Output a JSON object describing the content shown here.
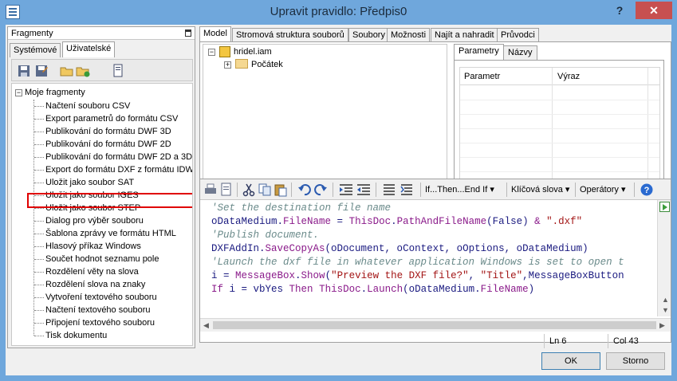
{
  "window": {
    "title": "Upravit pravidlo: Předpis0",
    "help_label": "?",
    "close_label": "✕"
  },
  "fragments": {
    "header": "Fragmenty",
    "tabs": [
      "Systémové",
      "Uživatelské"
    ],
    "active_tab": "Uživatelské",
    "toolbar_icons": [
      "save-icon",
      "save-as-icon",
      "open-folder-icon",
      "add-folder-icon",
      "document-icon"
    ],
    "root_label": "Moje fragmenty",
    "items": [
      "Načtení souboru CSV",
      "Export parametrů do formátu CSV",
      "Publikování do formátu DWF 3D",
      "Publikování do formátu DWF 2D",
      "Publikování do formátu DWF 2D a 3D",
      "Export do formátu DXF z formátu IDW",
      "Uložit jako soubor SAT",
      "Uložit jako soubor IGES",
      "Uložit jako soubor STEP",
      "Dialog pro výběr souboru",
      "Šablona zprávy ve formátu HTML",
      "Hlasový příkaz Windows",
      "Součet hodnot seznamu pole",
      "Rozdělení věty na slova",
      "Rozdělení slova na znaky",
      "Vytvoření textového souboru",
      "Načtení textového souboru",
      "Připojení textového souboru",
      "Tisk dokumentu"
    ],
    "highlighted_item": "Export do formátu DXF z formátu IDW"
  },
  "main_tabs": [
    "Model",
    "Stromová struktura souborů",
    "Soubory",
    "Možnosti",
    "Najít a nahradit",
    "Průvodci"
  ],
  "active_main_tab": "Model",
  "model_tree": {
    "root": "hridel.iam",
    "child": "Počátek"
  },
  "params_panel": {
    "tabs": [
      "Parametry",
      "Názvy"
    ],
    "active_tab": "Parametry",
    "columns": [
      "Parametr",
      "Výraz"
    ]
  },
  "editor_toolbar": {
    "icons": [
      "print-icon",
      "print-preview-icon",
      "cut-icon",
      "copy-icon",
      "paste-icon",
      "undo-icon",
      "redo-icon",
      "indent-icon",
      "outdent-icon",
      "comment-icon",
      "uncomment-icon"
    ],
    "dropdowns": [
      "If...Then...End If",
      "Klíčová slova",
      "Operátory"
    ],
    "help_icon": "help-icon"
  },
  "code_lines": [
    {
      "parts": [
        {
          "t": "'Set the destination file name",
          "c": "c-com"
        }
      ]
    },
    {
      "parts": [
        {
          "t": "oDataMedium",
          "c": "c-plain"
        },
        {
          "t": ".",
          "c": "c-plain"
        },
        {
          "t": "FileName",
          "c": "c-obj"
        },
        {
          "t": " = ",
          "c": "c-plain"
        },
        {
          "t": "ThisDoc",
          "c": "c-obj"
        },
        {
          "t": ".",
          "c": "c-plain"
        },
        {
          "t": "PathAndFileName",
          "c": "c-obj"
        },
        {
          "t": "(False) ",
          "c": "c-plain"
        },
        {
          "t": "&",
          "c": "c-kw"
        },
        {
          "t": " ",
          "c": "c-plain"
        },
        {
          "t": "\".dxf\"",
          "c": "c-str"
        }
      ]
    },
    {
      "parts": [
        {
          "t": "'Publish document.",
          "c": "c-com"
        }
      ]
    },
    {
      "parts": [
        {
          "t": "DXFAddIn",
          "c": "c-plain"
        },
        {
          "t": ".",
          "c": "c-plain"
        },
        {
          "t": "SaveCopyAs",
          "c": "c-obj"
        },
        {
          "t": "(oDocument, oContext, oOptions, oDataMedium)",
          "c": "c-plain"
        }
      ]
    },
    {
      "parts": [
        {
          "t": "'Launch the dxf file in whatever application Windows is set to open t",
          "c": "c-com"
        }
      ]
    },
    {
      "parts": [
        {
          "t": "i = ",
          "c": "c-plain"
        },
        {
          "t": "MessageBox",
          "c": "c-obj"
        },
        {
          "t": ".",
          "c": "c-plain"
        },
        {
          "t": "Show",
          "c": "c-obj"
        },
        {
          "t": "(",
          "c": "c-plain"
        },
        {
          "t": "\"Preview the DXF file?\"",
          "c": "c-str"
        },
        {
          "t": ", ",
          "c": "c-plain"
        },
        {
          "t": "\"Title\"",
          "c": "c-str"
        },
        {
          "t": ",MessageBoxButton",
          "c": "c-plain"
        }
      ]
    },
    {
      "parts": [
        {
          "t": "If",
          "c": "c-kw"
        },
        {
          "t": " i = vbYes ",
          "c": "c-plain"
        },
        {
          "t": "Then",
          "c": "c-kw"
        },
        {
          "t": " ",
          "c": "c-plain"
        },
        {
          "t": "ThisDoc",
          "c": "c-obj"
        },
        {
          "t": ".",
          "c": "c-plain"
        },
        {
          "t": "Launch",
          "c": "c-obj"
        },
        {
          "t": "(oDataMedium.",
          "c": "c-plain"
        },
        {
          "t": "FileName",
          "c": "c-obj"
        },
        {
          "t": ")",
          "c": "c-plain"
        }
      ]
    }
  ],
  "status": {
    "line": "Ln 6",
    "col": "Col 43"
  },
  "buttons": {
    "ok": "OK",
    "cancel": "Storno"
  },
  "colors": {
    "title_bar": "#6fa7dc",
    "close_button": "#c75050",
    "highlight_border": "#e00000"
  }
}
